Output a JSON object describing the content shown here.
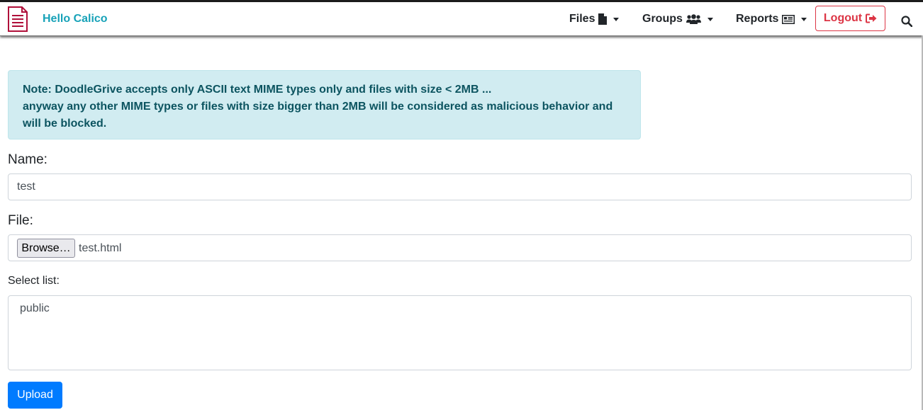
{
  "navbar": {
    "brand_text": "Hello Calico",
    "brand_icon": "document-icon",
    "files_label": "Files",
    "groups_label": "Groups",
    "reports_label": "Reports",
    "logout_label": "Logout",
    "colors": {
      "brand": "#17a2b8",
      "logout": "#dc3545",
      "logo": "#b0103a"
    }
  },
  "alert": {
    "line1": "Note: DoodleGrive accepts only ASCII text MIME types only and files with size < 2MB ...",
    "line2": "anyway any other MIME types or files with size bigger than 2MB will be considered as malicious behavior and will be blocked.",
    "colors": {
      "background": "#d1ecf1",
      "text": "#0c5460"
    }
  },
  "form": {
    "name_label": "Name:",
    "name_value": "test",
    "file_label": "File:",
    "browse_label": "Browse…",
    "file_name": "test.html",
    "select_label": "Select list:",
    "select_options": [
      "public"
    ],
    "upload_label": "Upload",
    "colors": {
      "upload": "#007bff"
    }
  }
}
